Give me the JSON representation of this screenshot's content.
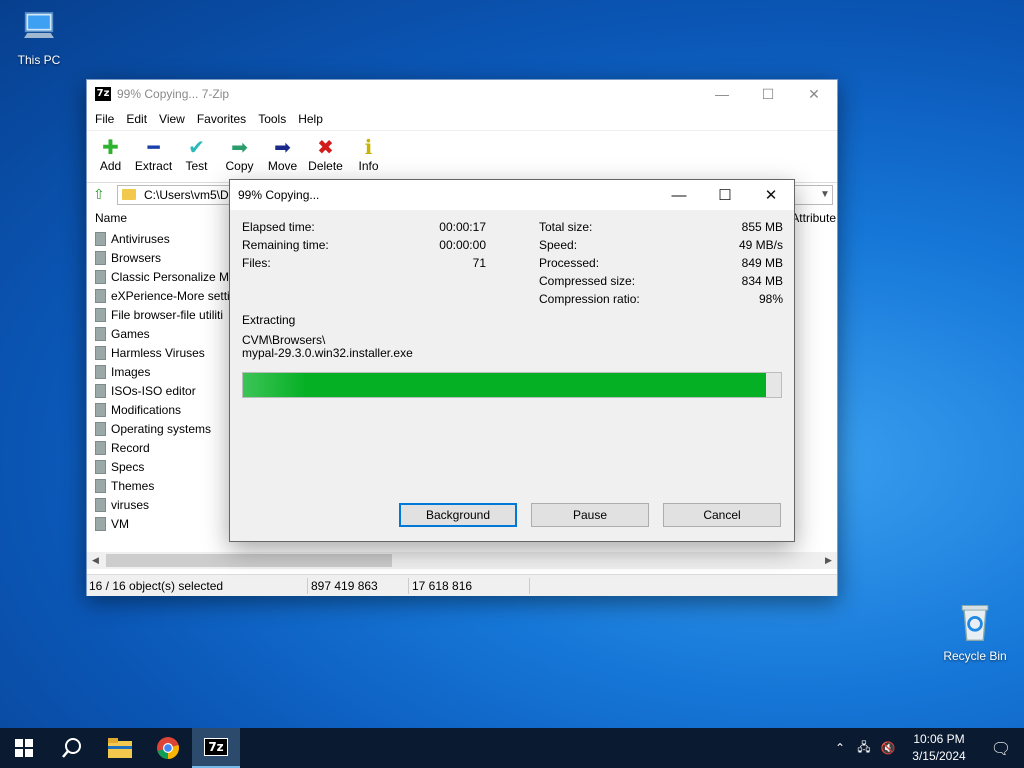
{
  "desktop": {
    "icons": [
      {
        "label": "This PC",
        "icon": "computer-icon"
      },
      {
        "label": "Recycle Bin",
        "icon": "recycle-bin-icon"
      }
    ]
  },
  "main_window": {
    "title": "99% Copying... 7-Zip",
    "app_icon_text": "7z",
    "menu": [
      "File",
      "Edit",
      "View",
      "Favorites",
      "Tools",
      "Help"
    ],
    "toolbar": [
      {
        "label": "Add",
        "icon": "add-icon",
        "color": "#2db32d"
      },
      {
        "label": "Extract",
        "icon": "extract-icon",
        "color": "#1a3fa8"
      },
      {
        "label": "Test",
        "icon": "test-icon",
        "color": "#2ab8b8"
      },
      {
        "label": "Copy",
        "icon": "copy-icon",
        "color": "#2a9d6a"
      },
      {
        "label": "Move",
        "icon": "move-icon",
        "color": "#1a2a8a"
      },
      {
        "label": "Delete",
        "icon": "delete-icon",
        "color": "#d21c1c"
      },
      {
        "label": "Info",
        "icon": "info-icon",
        "color": "#c8b400"
      }
    ],
    "address": "C:\\Users\\vm5\\De",
    "columns": {
      "name": "Name",
      "attributes": "Attribute"
    },
    "files": [
      "Antiviruses",
      "Browsers",
      "Classic Personalize Me",
      "eXPerience-More settin",
      "File browser-file utiliti",
      "Games",
      "Harmless Viruses",
      "Images",
      "ISOs-ISO editor",
      "Modifications",
      "Operating systems",
      "Record",
      "Specs",
      "Themes",
      "viruses",
      "VM"
    ],
    "status": {
      "selection": "16 / 16 object(s) selected",
      "size": "897 419 863",
      "packed": "17 618 816"
    }
  },
  "dialog": {
    "title": "99% Copying...",
    "left_stats": [
      {
        "label": "Elapsed time:",
        "value": "00:00:17"
      },
      {
        "label": "Remaining time:",
        "value": "00:00:00"
      },
      {
        "label": "Files:",
        "value": "71"
      }
    ],
    "right_stats": [
      {
        "label": "Total size:",
        "value": "855 MB"
      },
      {
        "label": "Speed:",
        "value": "49 MB/s"
      },
      {
        "label": "Processed:",
        "value": "849 MB"
      },
      {
        "label": "Compressed size:",
        "value": "834 MB"
      },
      {
        "label": "Compression ratio:",
        "value": "98%"
      }
    ],
    "action": "Extracting",
    "path_line1": "CVM\\Browsers\\",
    "path_line2": "mypal-29.3.0.win32.installer.exe",
    "progress_fraction": 0.972,
    "buttons": {
      "background": "Background",
      "pause": "Pause",
      "cancel": "Cancel"
    }
  },
  "taskbar": {
    "apps": [
      "start-icon",
      "search-icon",
      "file-explorer-icon",
      "chrome-icon",
      "7zip-icon"
    ],
    "time": "10:06 PM",
    "date": "3/15/2024"
  },
  "colors": {
    "progress": "#06b025",
    "accent": "#0078d7"
  }
}
